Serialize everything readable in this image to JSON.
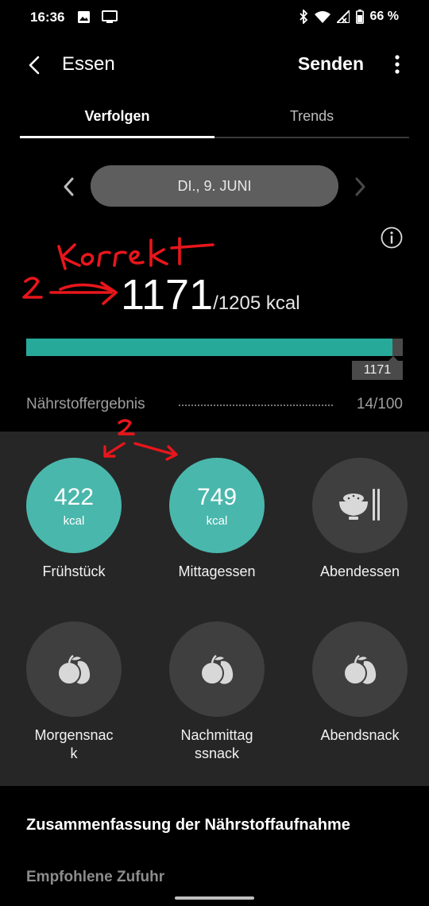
{
  "status_bar": {
    "time": "16:36",
    "battery": "66 %",
    "icons": [
      "image-icon",
      "screen-cast-icon",
      "bluetooth-icon",
      "wifi-icon",
      "signal-icon",
      "battery-icon"
    ]
  },
  "app_bar": {
    "title": "Essen",
    "send_label": "Senden",
    "icons": [
      "back-arrow-icon",
      "more-vert-icon"
    ]
  },
  "tabs": [
    {
      "label": "Verfolgen",
      "active": true
    },
    {
      "label": "Trends",
      "active": false
    }
  ],
  "date_nav": {
    "date": "DI., 9. JUNI",
    "icons": [
      "chevron-left-icon",
      "chevron-right-icon"
    ]
  },
  "calories": {
    "consumed": "1171",
    "goal": "/1205 kcal",
    "marker": "1171",
    "progress_fraction": 0.9718
  },
  "annotation": {
    "word": "Korrekt",
    "number": "2",
    "arrow_number": "2",
    "color": "#e8161b"
  },
  "nutrient_score": {
    "label": "Nährstoffergebnis",
    "value": "14/100"
  },
  "meals": [
    {
      "label": "Frühstück",
      "kcal": "422",
      "unit": "kcal",
      "logged": true
    },
    {
      "label": "Mittagessen",
      "kcal": "749",
      "unit": "kcal",
      "logged": true
    },
    {
      "label": "Abendessen",
      "icon": "rice-bowl-chopsticks-icon",
      "logged": false
    },
    {
      "label": "Morgensnac\nk",
      "icon": "fruit-icon",
      "logged": false
    },
    {
      "label": "Nachmittag\nssnack",
      "icon": "fruit-icon",
      "logged": false
    },
    {
      "label": "Abendsnack",
      "icon": "fruit-icon",
      "logged": false
    }
  ],
  "summary": {
    "title": "Zusammenfassung der Nährstoffaufnahme",
    "subtitle": "Empfohlene Zufuhr"
  },
  "colors": {
    "accent": "#27a99a",
    "meal_filled": "#4ab7ac",
    "panel": "#262626",
    "date_pill": "#5e5e5e"
  }
}
